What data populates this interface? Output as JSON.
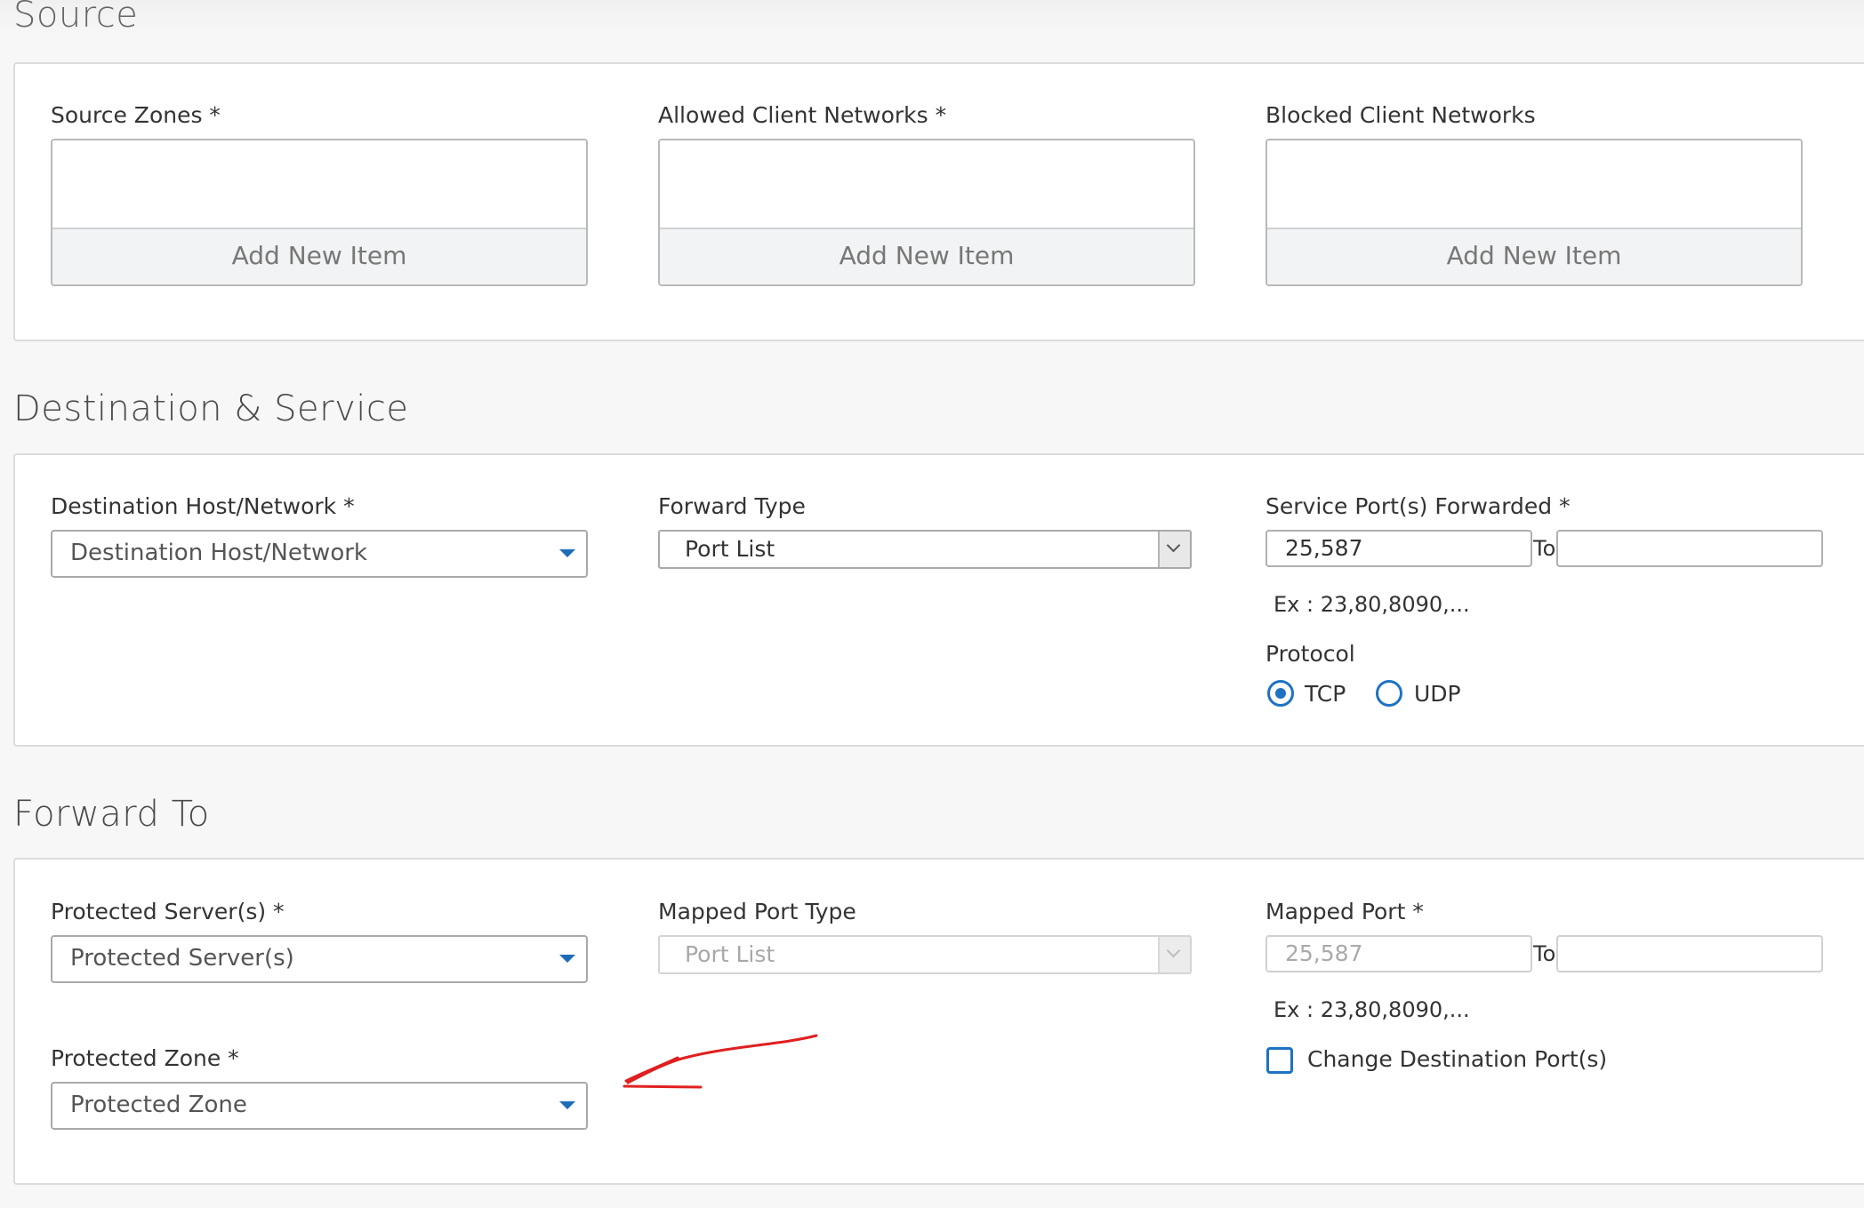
{
  "source": {
    "title": "Source",
    "zones": {
      "label": "Source Zones *",
      "add_label": "Add New Item"
    },
    "allowed": {
      "label": "Allowed Client Networks *",
      "add_label": "Add New Item"
    },
    "blocked": {
      "label": "Blocked Client Networks",
      "add_label": "Add New Item"
    }
  },
  "destination": {
    "title": "Destination & Service",
    "host_label": "Destination Host/Network *",
    "host_value": "Destination Host/Network",
    "forward_type_label": "Forward Type",
    "forward_type_value": "Port List",
    "service_ports_label": "Service Port(s) Forwarded *",
    "service_ports_value": "25,587",
    "to_label": "To",
    "to_value": "",
    "hint": "Ex : 23,80,8090,...",
    "protocol_label": "Protocol",
    "protocol_options": [
      "TCP",
      "UDP"
    ],
    "protocol_selected": "TCP"
  },
  "forward_to": {
    "title": "Forward To",
    "servers_label": "Protected Server(s) *",
    "servers_value": "Protected Server(s)",
    "mapped_type_label": "Mapped Port Type",
    "mapped_type_value": "Port List",
    "mapped_port_label": "Mapped Port *",
    "mapped_port_value": "25,587",
    "to_label": "To",
    "to_value": "",
    "hint": "Ex : 23,80,8090,...",
    "change_dest_label": "Change Destination Port(s)",
    "change_dest_checked": false,
    "zone_label": "Protected Zone *",
    "zone_value": "Protected Zone"
  },
  "colors": {
    "accent": "#1e72c3",
    "annotation": "#e02020"
  },
  "icons": [
    "caret-down-icon",
    "chevron-down-icon",
    "annotation-arrow"
  ]
}
